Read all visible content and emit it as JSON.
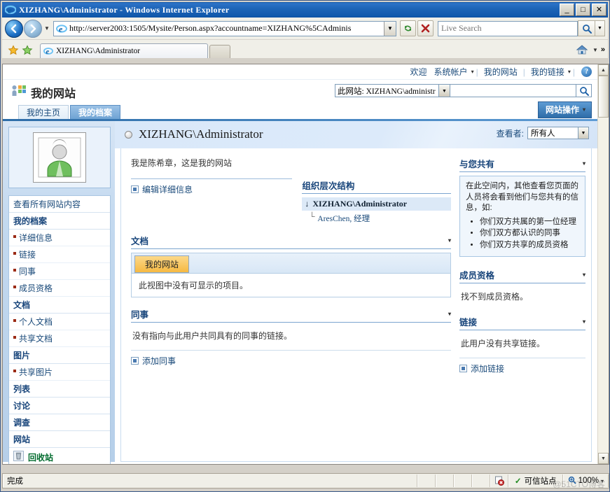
{
  "browser": {
    "window_title": "XIZHANG\\Administrator - Windows Internet Explorer",
    "minimize_label": "_",
    "maximize_label": "□",
    "close_label": "✕",
    "back_label": "⬅",
    "forward_label": "➡",
    "history_chevron": "▼",
    "url": "http://server2003:1505/Mysite/Person.aspx?accountname=XIZHANG%5CAdminis",
    "url_dropdown": "▼",
    "refresh_icon": "↻",
    "stop_icon": "✕",
    "search_placeholder": "Live Search",
    "search_value": "",
    "search_go_icon": "🔍",
    "search_dropdown": "▼",
    "tab_title": "XIZHANG\\Administrator",
    "favorites_star": "★",
    "add_favorite": "★",
    "home_dropdown": "▼",
    "toolbar_overflow": "»"
  },
  "sp_topbar": {
    "welcome": "欢迎",
    "account": "系统帐户",
    "account_chevron": "▾",
    "my_site": "我的网站",
    "my_links": "我的链接",
    "my_links_chevron": "▾",
    "separator": "|",
    "help_icon": "?"
  },
  "sp_header": {
    "site_title": "我的网站",
    "scope_label": "此网站: XIZHANG\\administr",
    "scope_chevron": "▼",
    "search_value": "",
    "search_icon": "🔍",
    "tabs": [
      {
        "label": "我的主页",
        "selected": false
      },
      {
        "label": "我的档案",
        "selected": true
      }
    ],
    "site_actions": "网站操作",
    "site_actions_chevron": "▾"
  },
  "sidebar": {
    "view_all": "查看所有网站内容",
    "groups": [
      {
        "heading": "我的档案",
        "items": [
          "详细信息",
          "链接",
          "同事",
          "成员资格"
        ]
      },
      {
        "heading": "文档",
        "items": [
          "个人文档",
          "共享文档"
        ]
      },
      {
        "heading": "图片",
        "items": [
          "共享图片"
        ]
      },
      {
        "heading": "列表",
        "items": []
      },
      {
        "heading": "讨论",
        "items": []
      },
      {
        "heading": "调查",
        "items": []
      },
      {
        "heading": "网站",
        "items": []
      }
    ],
    "recycle_bin": "回收站",
    "recycle_icon": "recycle-bin-icon"
  },
  "person": {
    "name": "XIZHANG\\Administrator",
    "status_icon": "presence-offline-icon",
    "viewer_label": "查看者:",
    "viewer_value": "所有人",
    "viewer_chevron": "▼",
    "about": "我是陈希章，这是我的网站",
    "edit_details": "编辑详细信息"
  },
  "org": {
    "title": "组织层次结构",
    "root_arrow": "↓",
    "root": "XIZHANG\\Administrator",
    "child": "AresChen, 经理"
  },
  "documents": {
    "title": "文档",
    "menu_chevron": "▾",
    "active_tab": "我的网站",
    "empty_message": "此视图中没有可显示的项目。"
  },
  "colleagues": {
    "title": "同事",
    "menu_chevron": "▾",
    "empty_message": "没有指向与此用户共同具有的同事的链接。",
    "add_link": "添加同事"
  },
  "shared_with_you": {
    "title": "与您共有",
    "menu_chevron": "▾",
    "intro": "在此空间内，其他查看您页面的人员将会看到他们与您共有的信息，如:",
    "bullets": [
      "你们双方共属的第一位经理",
      "你们双方都认识的同事",
      "你们双方共享的成员资格"
    ]
  },
  "memberships": {
    "title": "成员资格",
    "menu_chevron": "▾",
    "empty_message": "找不到成员资格。"
  },
  "links": {
    "title": "链接",
    "menu_chevron": "▾",
    "empty_message": "此用户没有共享链接。",
    "add_link": "添加链接"
  },
  "statusbar": {
    "status": "完成",
    "zone": "可信站点",
    "zone_check": "✓",
    "zoom": "100%",
    "zoom_chevron": "▾",
    "watermark": "@51CTO博客"
  },
  "scrollbar": {
    "up_arrow": "▲",
    "down_arrow": "▼"
  },
  "colors": {
    "accent": "#2e6da8",
    "title_blue": "#17447a",
    "link_blue": "#1a4a7a",
    "tab_orange": "#f6b942",
    "recycle_green": "#006b2d"
  }
}
